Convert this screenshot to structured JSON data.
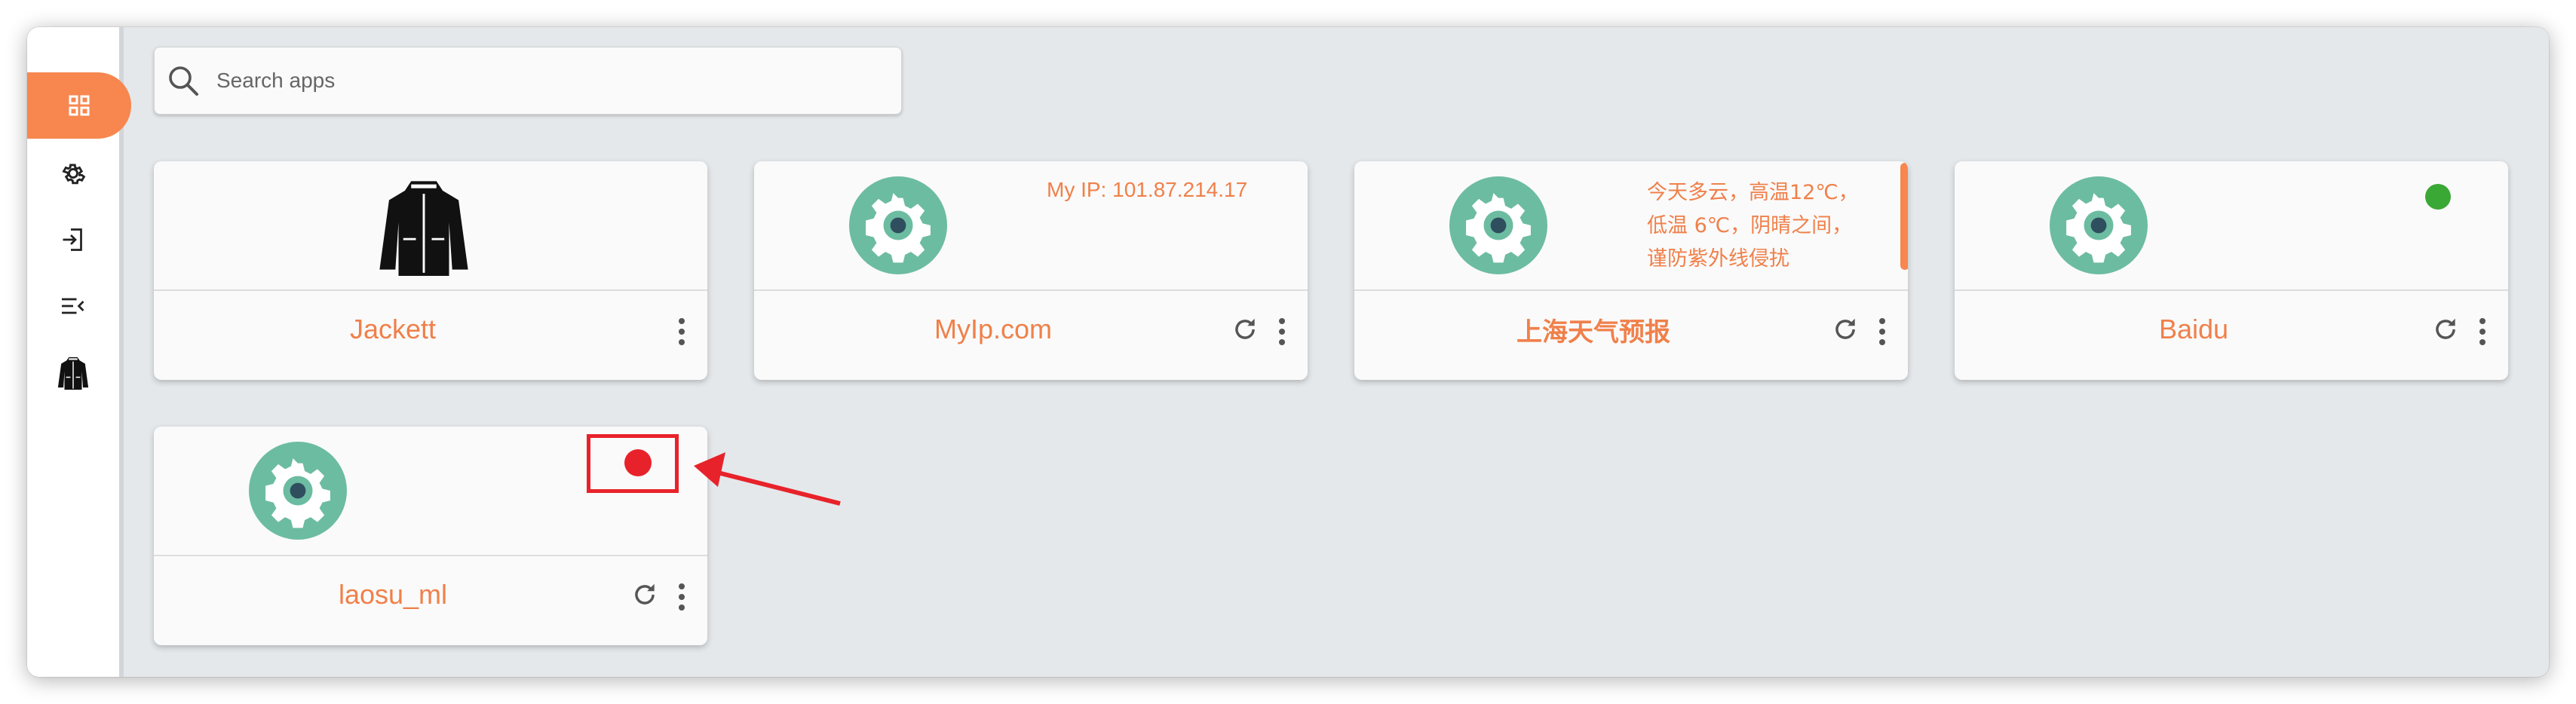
{
  "sidebar": {
    "items": [
      {
        "name": "dashboard-icon",
        "active": true
      },
      {
        "name": "gear-icon",
        "active": false
      },
      {
        "name": "login-icon",
        "active": false
      },
      {
        "name": "collapse-menu-icon",
        "active": false
      },
      {
        "name": "jacket-icon",
        "active": false
      }
    ]
  },
  "search": {
    "placeholder": "Search apps",
    "value": ""
  },
  "apps": [
    {
      "name": "Jackett",
      "icon": "jacket-icon",
      "has_refresh": false
    },
    {
      "name": "MyIp.com",
      "icon": "gear-icon",
      "extra": "My IP: 101.87.214.17",
      "has_refresh": true
    },
    {
      "name": "上海天气预报",
      "icon": "gear-icon",
      "extra": "今天多云，高温12℃，低温 6℃，阴晴之间，谨防紫外线侵扰",
      "has_refresh": true
    },
    {
      "name": "Baidu",
      "icon": "gear-icon",
      "status": "online",
      "status_color": "#3aa835",
      "has_refresh": true
    },
    {
      "name": "laosu_ml",
      "icon": "gear-icon",
      "status": "offline",
      "status_color": "#e8222a",
      "has_refresh": true
    }
  ],
  "annotation": {
    "color": "#e8222a"
  },
  "colors": {
    "accent": "#f7874f",
    "gear_bg": "#6cbca2"
  }
}
